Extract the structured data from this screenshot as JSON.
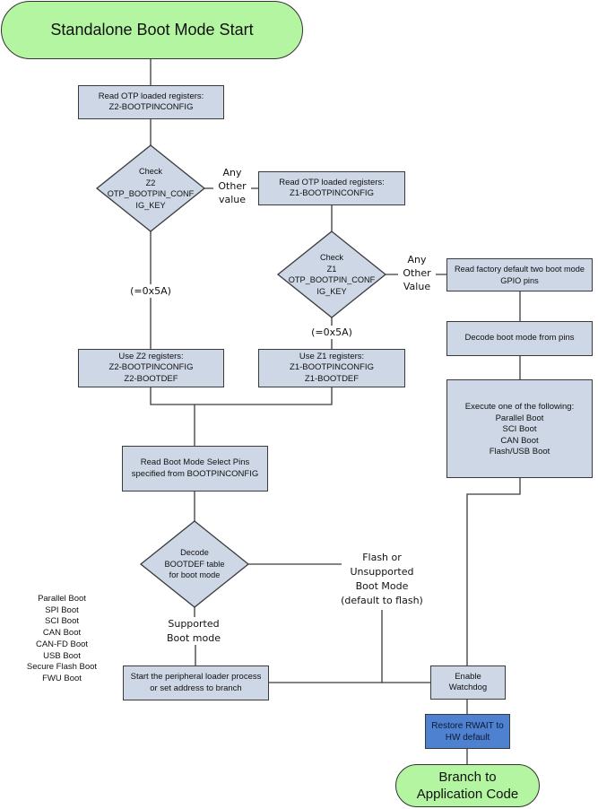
{
  "diagram": {
    "start": {
      "label": "Standalone Boot Mode Start"
    },
    "read_z2": {
      "lines": [
        "Read OTP loaded registers:",
        "Z2-BOOTPINCONFIG"
      ]
    },
    "check_z2": {
      "lines": [
        "Check",
        "Z2",
        "OTP_BOOTPIN_CONF",
        "IG_KEY"
      ]
    },
    "check_z2_other_label": {
      "lines": [
        "Any",
        "Other",
        "value"
      ]
    },
    "check_z2_match_label": "(=0x5A)",
    "read_z1": {
      "lines": [
        "Read OTP loaded registers:",
        "Z1-BOOTPINCONFIG"
      ]
    },
    "check_z1": {
      "lines": [
        "Check",
        "Z1",
        "OTP_BOOTPIN_CONF",
        "IG_KEY"
      ]
    },
    "check_z1_other_label": {
      "lines": [
        "Any",
        "Other",
        "Value"
      ]
    },
    "check_z1_match_label": "(=0x5A)",
    "read_factory": {
      "lines": [
        "Read factory default two boot mode",
        "GPIO pins"
      ]
    },
    "decode_pins": {
      "lines": [
        "Decode boot mode from pins"
      ]
    },
    "execute": {
      "lines": [
        "Execute one of the following:",
        "Parallel Boot",
        "SCI Boot",
        "CAN Boot",
        "Flash/USB Boot"
      ]
    },
    "use_z2": {
      "lines": [
        "Use Z2 registers:",
        "Z2-BOOTPINCONFIG",
        "Z2-BOOTDEF"
      ]
    },
    "use_z1": {
      "lines": [
        "Use Z1 registers:",
        "Z1-BOOTPINCONFIG",
        "Z1-BOOTDEF"
      ]
    },
    "read_select_pins": {
      "lines": [
        "Read Boot Mode Select Pins",
        "specified from BOOTPINCONFIG"
      ]
    },
    "decode_bootdef": {
      "lines": [
        "Decode",
        "BOOTDEF table",
        "for boot mode"
      ]
    },
    "unsupported_label": {
      "lines": [
        "Flash or",
        "Unsupported",
        "Boot Mode",
        "(default to flash)"
      ]
    },
    "supported_label": {
      "lines": [
        "Supported",
        "Boot mode"
      ]
    },
    "supported_modes": [
      "Parallel Boot",
      "SPI Boot",
      "SCI Boot",
      "CAN Boot",
      "CAN-FD Boot",
      "USB Boot",
      "Secure Flash Boot",
      "FWU Boot"
    ],
    "start_loader": {
      "lines": [
        "Start the peripheral loader process",
        "or set address to branch"
      ]
    },
    "enable_watchdog": {
      "lines": [
        "Enable",
        "Watchdog"
      ]
    },
    "restore_rwait": {
      "lines": [
        "Restore RWAIT to",
        "HW default"
      ]
    },
    "end": {
      "lines": [
        "Branch to",
        "Application Code"
      ]
    }
  },
  "colors": {
    "terminal_fill": "#b3f5a0",
    "process_fill": "#cdd7e6",
    "highlight_fill": "#4f81d1",
    "stroke": "#3a3a3a"
  }
}
